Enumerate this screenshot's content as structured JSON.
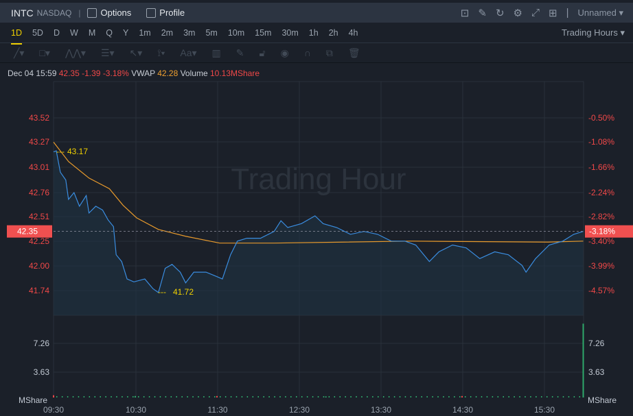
{
  "header": {
    "symbol": "INTC",
    "exchange": "NASDAQ",
    "options_label": "Options",
    "profile_label": "Profile",
    "layout_name": "Unnamed"
  },
  "periods": [
    "1D",
    "5D",
    "D",
    "W",
    "M",
    "Q",
    "Y",
    "1m",
    "2m",
    "3m",
    "5m",
    "10m",
    "15m",
    "30m",
    "1h",
    "2h",
    "4h"
  ],
  "active_period": "1D",
  "session_select": "Trading Hours",
  "quote": {
    "datetime": "Dec 04 15:59",
    "price": "42.35",
    "change": "-1.39",
    "change_pct": "-3.18%",
    "vwap_label": "VWAP",
    "vwap": "42.28",
    "volume_label": "Volume",
    "volume": "10.13MShare"
  },
  "colors": {
    "price_line": "#3a8de0",
    "vwap_line": "#e89a2c",
    "down": "#f04848",
    "accent": "#f0d000"
  },
  "chart_data": {
    "type": "line",
    "watermark": "Trading Hour",
    "x_ticks": [
      "09:30",
      "10:30",
      "11:30",
      "12:30",
      "13:30",
      "14:30",
      "15:30"
    ],
    "price_ticks": [
      "43.52",
      "43.27",
      "43.01",
      "42.76",
      "42.51",
      "42.25",
      "42.00",
      "41.74"
    ],
    "pct_ticks": [
      "-0.50%",
      "-1.08%",
      "-1.66%",
      "-2.24%",
      "-2.82%",
      "-3.40%",
      "-3.99%",
      "-4.57%"
    ],
    "current_price": "42.35",
    "current_pct": "-3.18%",
    "high_label": "43.17",
    "low_label": "41.72",
    "volume_ticks": [
      "7.26",
      "3.63"
    ],
    "volume_unit": "MShare",
    "ylim": [
      41.74,
      43.52
    ],
    "price_series": [
      [
        0,
        43.17
      ],
      [
        2,
        43.18
      ],
      [
        5,
        42.96
      ],
      [
        9,
        42.88
      ],
      [
        11,
        42.68
      ],
      [
        15,
        42.75
      ],
      [
        19,
        42.61
      ],
      [
        24,
        42.72
      ],
      [
        26,
        42.54
      ],
      [
        31,
        42.61
      ],
      [
        36,
        42.57
      ],
      [
        40,
        42.47
      ],
      [
        44,
        42.4
      ],
      [
        46,
        42.11
      ],
      [
        50,
        42.04
      ],
      [
        54,
        41.86
      ],
      [
        59,
        41.83
      ],
      [
        67,
        41.86
      ],
      [
        73,
        41.76
      ],
      [
        77,
        41.72
      ],
      [
        82,
        41.97
      ],
      [
        87,
        42.01
      ],
      [
        93,
        41.93
      ],
      [
        97,
        41.82
      ],
      [
        103,
        41.93
      ],
      [
        112,
        41.93
      ],
      [
        119,
        41.89
      ],
      [
        124,
        41.86
      ],
      [
        130,
        42.11
      ],
      [
        135,
        42.25
      ],
      [
        142,
        42.28
      ],
      [
        152,
        42.28
      ],
      [
        162,
        42.35
      ],
      [
        167,
        42.46
      ],
      [
        172,
        42.39
      ],
      [
        182,
        42.43
      ],
      [
        192,
        42.51
      ],
      [
        198,
        42.43
      ],
      [
        208,
        42.39
      ],
      [
        218,
        42.32
      ],
      [
        228,
        42.35
      ],
      [
        238,
        42.32
      ],
      [
        248,
        42.25
      ],
      [
        258,
        42.25
      ],
      [
        266,
        42.21
      ],
      [
        276,
        42.04
      ],
      [
        283,
        42.14
      ],
      [
        293,
        42.21
      ],
      [
        303,
        42.18
      ],
      [
        313,
        42.07
      ],
      [
        324,
        42.14
      ],
      [
        334,
        42.11
      ],
      [
        344,
        42.0
      ],
      [
        347,
        41.93
      ],
      [
        354,
        42.07
      ],
      [
        364,
        42.21
      ],
      [
        374,
        42.25
      ],
      [
        382,
        42.32
      ],
      [
        389,
        42.35
      ]
    ],
    "vwap_series": [
      [
        0,
        43.27
      ],
      [
        11,
        43.07
      ],
      [
        26,
        42.9
      ],
      [
        41,
        42.79
      ],
      [
        51,
        42.62
      ],
      [
        61,
        42.49
      ],
      [
        77,
        42.37
      ],
      [
        97,
        42.3
      ],
      [
        122,
        42.23
      ],
      [
        162,
        42.23
      ],
      [
        262,
        42.25
      ],
      [
        363,
        42.24
      ],
      [
        389,
        42.25
      ]
    ],
    "volume_series": [
      [
        0,
        0.3
      ],
      [
        60,
        0.2
      ],
      [
        120,
        0.2
      ],
      [
        200,
        0.15
      ],
      [
        300,
        0.2
      ],
      [
        389,
        9.9
      ]
    ]
  }
}
